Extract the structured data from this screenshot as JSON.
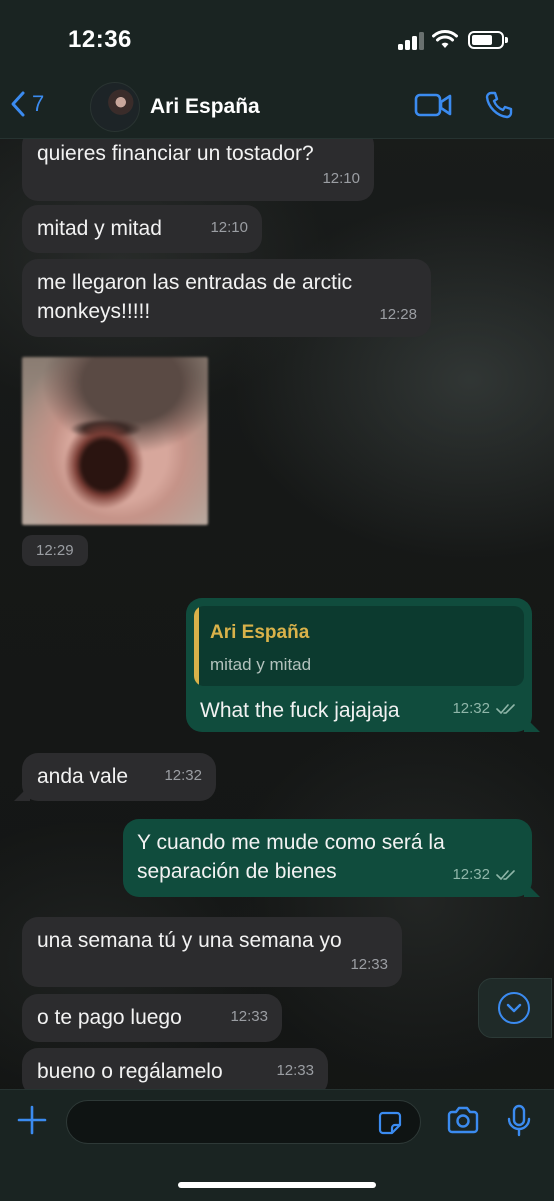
{
  "status": {
    "time": "12:36"
  },
  "header": {
    "back_count": "7",
    "contact_name": "Ari España"
  },
  "messages": [
    {
      "text": "quieres financiar un tostador?",
      "time": "12:10"
    },
    {
      "text": "mitad y mitad",
      "time": "12:10"
    },
    {
      "text": "me llegaron las entradas de arctic monkeys!!!!!",
      "time": "12:28"
    },
    {
      "time": "12:29",
      "image": "blurred-screaming-face-photo"
    },
    {
      "quote_author": "Ari España",
      "quote_text": "mitad y mitad",
      "text": "What the fuck jajajaja",
      "time": "12:32"
    },
    {
      "text": "anda vale",
      "time": "12:32"
    },
    {
      "text": "Y cuando me mude como será la separación de bienes",
      "time": "12:32"
    },
    {
      "text": "una semana tú y una semana yo",
      "time": "12:33"
    },
    {
      "text": "o te pago luego",
      "time": "12:33"
    },
    {
      "text": "bueno o regálamelo",
      "time": "12:33"
    }
  ],
  "input": {
    "placeholder": "",
    "value": ""
  },
  "colors": {
    "accent": "#3b8bf0",
    "outgoing_bubble": "#104c3d",
    "incoming_bubble": "#2c2c2e",
    "quote_author": "#d9b24a"
  },
  "icons": [
    "chevron-left-icon",
    "video-camera-icon",
    "phone-icon",
    "plus-icon",
    "sticker-icon",
    "camera-icon",
    "microphone-icon",
    "chevron-down-icon",
    "double-check-icon"
  ]
}
